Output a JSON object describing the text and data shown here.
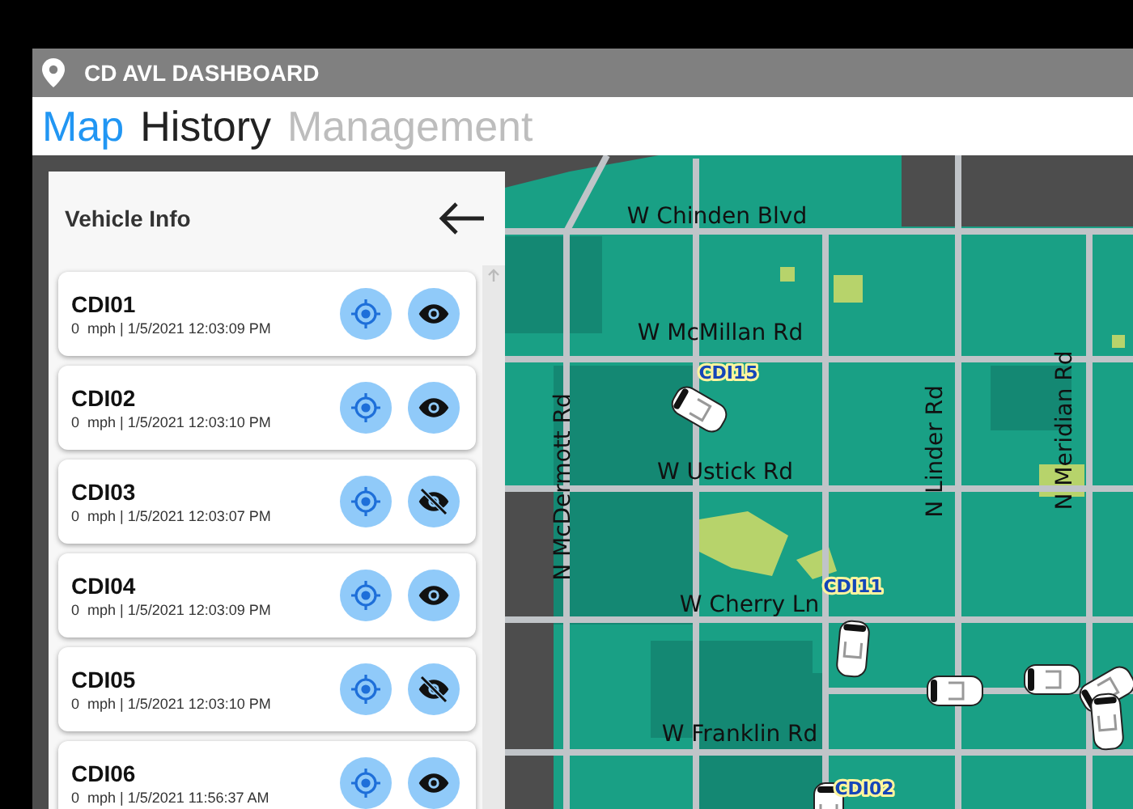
{
  "window": {
    "title": "CD AVL DASHBOARD"
  },
  "tabs": [
    {
      "label": "Map",
      "selected": true,
      "disabled": false
    },
    {
      "label": "History",
      "selected": false,
      "disabled": false
    },
    {
      "label": "Management",
      "selected": false,
      "disabled": true
    }
  ],
  "panel": {
    "title": "Vehicle Info"
  },
  "vehicles": [
    {
      "name": "CDI01",
      "status": "0  mph | 1/5/2021 12:03:09 PM",
      "visible": true
    },
    {
      "name": "CDI02",
      "status": "0  mph | 1/5/2021 12:03:10 PM",
      "visible": true
    },
    {
      "name": "CDI03",
      "status": "0  mph | 1/5/2021 12:03:07 PM",
      "visible": false
    },
    {
      "name": "CDI04",
      "status": "0  mph | 1/5/2021 12:03:09 PM",
      "visible": true
    },
    {
      "name": "CDI05",
      "status": "0  mph | 1/5/2021 12:03:10 PM",
      "visible": false
    },
    {
      "name": "CDI06",
      "status": "0  mph | 1/5/2021 11:56:37 AM",
      "visible": true
    }
  ],
  "map": {
    "labels": [
      {
        "label": "W Chinden Blvd",
        "kind": "horizontal"
      },
      {
        "label": "W McMillan Rd",
        "kind": "horizontal"
      },
      {
        "label": "CDI15",
        "kind": "vehicle"
      },
      {
        "label": "N McDermott Rd",
        "kind": "vertical"
      },
      {
        "label": "W Ustick Rd",
        "kind": "horizontal"
      },
      {
        "label": "N Linder Rd",
        "kind": "vertical"
      },
      {
        "label": "N Meridian Rd",
        "kind": "vertical"
      },
      {
        "label": "CDI11",
        "kind": "vehicle"
      },
      {
        "label": "W Cherry Ln",
        "kind": "horizontal"
      },
      {
        "label": "W Franklin Rd",
        "kind": "horizontal"
      },
      {
        "label": "CDI02",
        "kind": "vehicle"
      }
    ]
  }
}
